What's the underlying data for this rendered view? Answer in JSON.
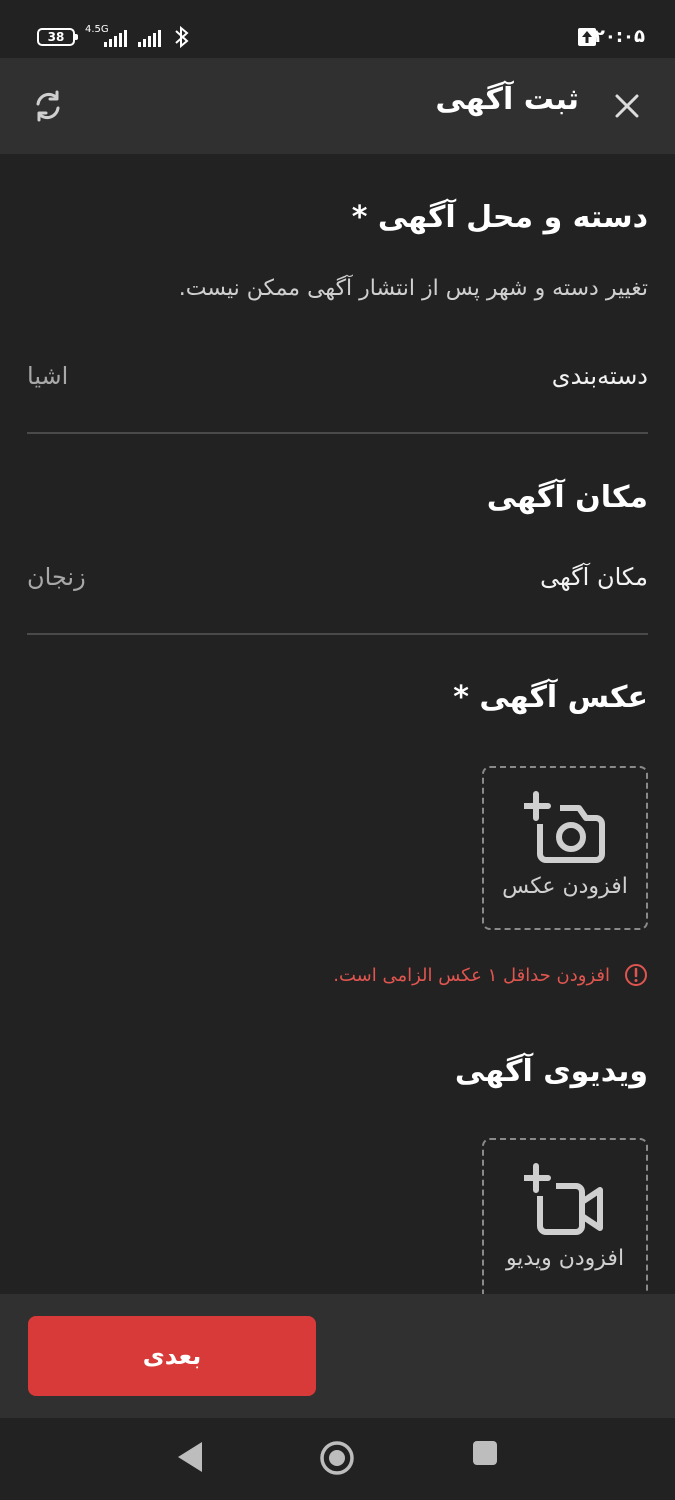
{
  "status_bar": {
    "battery": "38",
    "network": "4.5G",
    "time": "۲۰:۰۵"
  },
  "header": {
    "title": "ثبت آگهی",
    "icons": {
      "close": "close-icon",
      "refresh": "refresh-icon"
    }
  },
  "category_section": {
    "title": "دسته و محل آگهی *",
    "hint": "تغییر دسته و شهر پس از انتشار آگهی ممکن نیست.",
    "field_label": "دسته‌بندی",
    "field_value": "اشیا"
  },
  "location_section": {
    "title": "مکان آگهی",
    "field_label": "مکان آگهی",
    "field_value": "زنجان"
  },
  "photo_section": {
    "title": "عکس آگهی *",
    "add_label": "افزودن عکس",
    "error": "افزودن حداقل ۱ عکس الزامی است."
  },
  "video_section": {
    "title": "ویدیوی آگهی",
    "add_label": "افزودن ویدیو"
  },
  "footer": {
    "next_label": "بعدی"
  },
  "colors": {
    "background": "#222222",
    "header": "#303030",
    "accent": "#d83a3a",
    "error": "#e0554f"
  }
}
